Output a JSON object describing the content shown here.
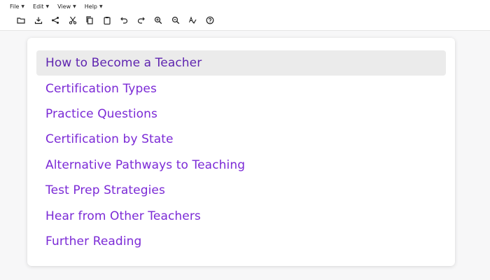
{
  "menu": {
    "items": [
      {
        "label": "File"
      },
      {
        "label": "Edit"
      },
      {
        "label": "View"
      },
      {
        "label": "Help"
      }
    ]
  },
  "toolbar": {
    "icons": [
      "folder-icon",
      "download-icon",
      "share-icon",
      "scissors-icon",
      "copy-icon",
      "clipboard-icon",
      "undo-icon",
      "redo-icon",
      "zoom-in-icon",
      "zoom-out-icon",
      "spellcheck-icon",
      "help-icon"
    ]
  },
  "nav": {
    "items": [
      {
        "label": "How to Become a Teacher",
        "active": true
      },
      {
        "label": "Certification Types",
        "active": false
      },
      {
        "label": "Practice Questions",
        "active": false
      },
      {
        "label": "Certification by State",
        "active": false
      },
      {
        "label": "Alternative Pathways to Teaching",
        "active": false
      },
      {
        "label": "Test Prep Strategies",
        "active": false
      },
      {
        "label": "Hear from Other Teachers",
        "active": false
      },
      {
        "label": "Further Reading",
        "active": false
      }
    ]
  },
  "colors": {
    "link": "#7b2ad6",
    "active_bg": "#ebebeb",
    "background": "#f7f7f8"
  }
}
